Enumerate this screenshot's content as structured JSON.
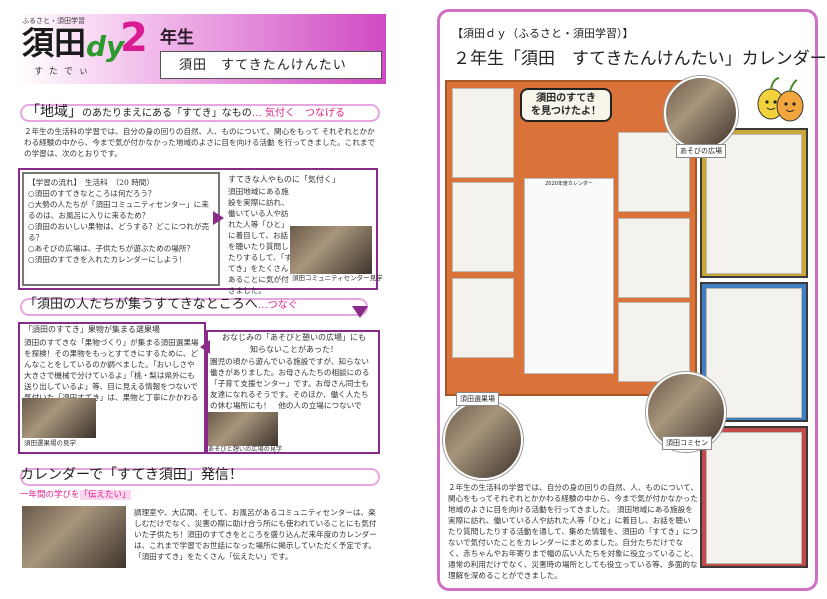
{
  "header": {
    "small_label": "ふるさと・須田学習",
    "brand_suda": "須田",
    "brand_dy": "dy",
    "brand_two": "2",
    "brand_ruby": "すたでぃ",
    "grade": "年生",
    "subtitle": "須田　すてきたんけんたい"
  },
  "section1": {
    "title_main": "「地域」",
    "title_rest": "のあたりまえにある「すてき」なもの",
    "title_link": "… 気付く　つなげる",
    "intro": "２年生の生活科の学習では、自分の身の回りの自然、人、ものについて、関心をもって それぞれとかかわる経験の中から、今まで気が付かなかった地域のよさに目を向ける活動 を行ってきました。これまでの学習は、次のとおりです。",
    "flow_title": "【学習の流れ】　生活科　（20 時間）",
    "flow_items": [
      "○須田のすてきなところは何だろう？",
      "○大勢の人たちが「須田コミュニティセンター」に来るのは、お風呂に入りに来るため？",
      "○須田のおいしい果物は、どうする？どこにつれが売る？",
      "○あそびの広場は、子供たちが遊ぶための場所？",
      "○須田のすてきを入れたカレンダーにしよう！"
    ],
    "side_title": "すてきな人やものに「気付く」",
    "side_text": "須田地域にある施設を実際に訪れ、働いている人や訪れた人等「ひと」に着目して、お話を聴いたり質問したりするして、「すてき」をたくさんあることに気が付きました。",
    "photo_caption": "須田コミュニティセンター見学"
  },
  "section2": {
    "title": "「須田の人たちが集うすてきなところへ",
    "title_link": "…つなぐ",
    "left_title": "「須田のすてき」果物が集まる選果場",
    "left_text": "須田のすてきな「果物づくり」が集まる須田選果場を探検！その果物をもっとすてきにするために、どんなことをしているのか調べました。「おいしさや大きさで機械で分けているよ」「桃・梨は県外にも送り出しているよ」等、目に見える情報をつないで気付いた「須田すてき」は、果物と丁寧にかかわる人たちでした。",
    "left_caption": "須田選果場の見学",
    "right_title_line1": "おなじみの「あそびと憩いの広場」にも",
    "right_title_line2": "知らないことがあった！",
    "right_text": "園児の頃から遊んでいる施設ですが、知らない働きがありました。お母さんたちの相談にのる「子育て支援センター」です。お母さん同士も友達になれるそうです。そのほか、働く人たちの休む場所にも！　他の人の立場につないで「すてき」発見",
    "right_caption": "あそびと憩いの広場の見学"
  },
  "section3": {
    "title": "カレンダーで「すてき須田」発信！",
    "subtitle_pre": "一年間の学びを",
    "subtitle_em": "「伝えたい」",
    "text": "調理室や、大広間、そして、お風呂があるコミュニティセンターは、楽しむだけでなく、災害の際に助け合う所にも使われていることにも気付いた子供たち！須田のすてきをところを盛り込んだ来年度のカレンダーは、これまで学習でお世話になった場所に掲示していただく予定です。「須田すてき」をたくさん「伝えたい」です。"
  },
  "right": {
    "heading": "【須田ｄｙ（ふるさと・須田学習）】",
    "title": "２年生「須田　すてきたんけんたい」カレンダー",
    "board_sign_line1": "須田のすてき",
    "board_sign_line2": "を見つけたよ！",
    "calendar_title": "2020年度カレンダー",
    "circle_label_1": "あそびの広場",
    "circle_label_2": "須田選果場",
    "circle_label_3": "須田コミセン",
    "text": "２年生の生活科の学習では、自分の身の回りの自然、人、ものについて、関心をもってそれぞれとかかわる経験の中から、今まで気が付かなかった地域のよさに目を向ける活動を行ってきました。 須田地域にある施設を実際に訪れ、働いている人や訪れた人等「ひと」に着目し、お話を聴いたり質問したりする活動を通して、集めた情報を、須田の「すてき」につないで気付いたことをカレンダーにまとめました。自分たちだけでなく、赤ちゃんやお年寄りまで幅の広い人たちを対象に役立っていること、通常の利用だけでなく、災害時の場所としても役立っている等、多面的な理解を深めることができました。"
  },
  "colors": {
    "accent_pink": "#e0208a",
    "frame_pink": "#cf6fc6",
    "box_purple": "#8a2a8a",
    "brand_green": "#2c9a2c"
  }
}
